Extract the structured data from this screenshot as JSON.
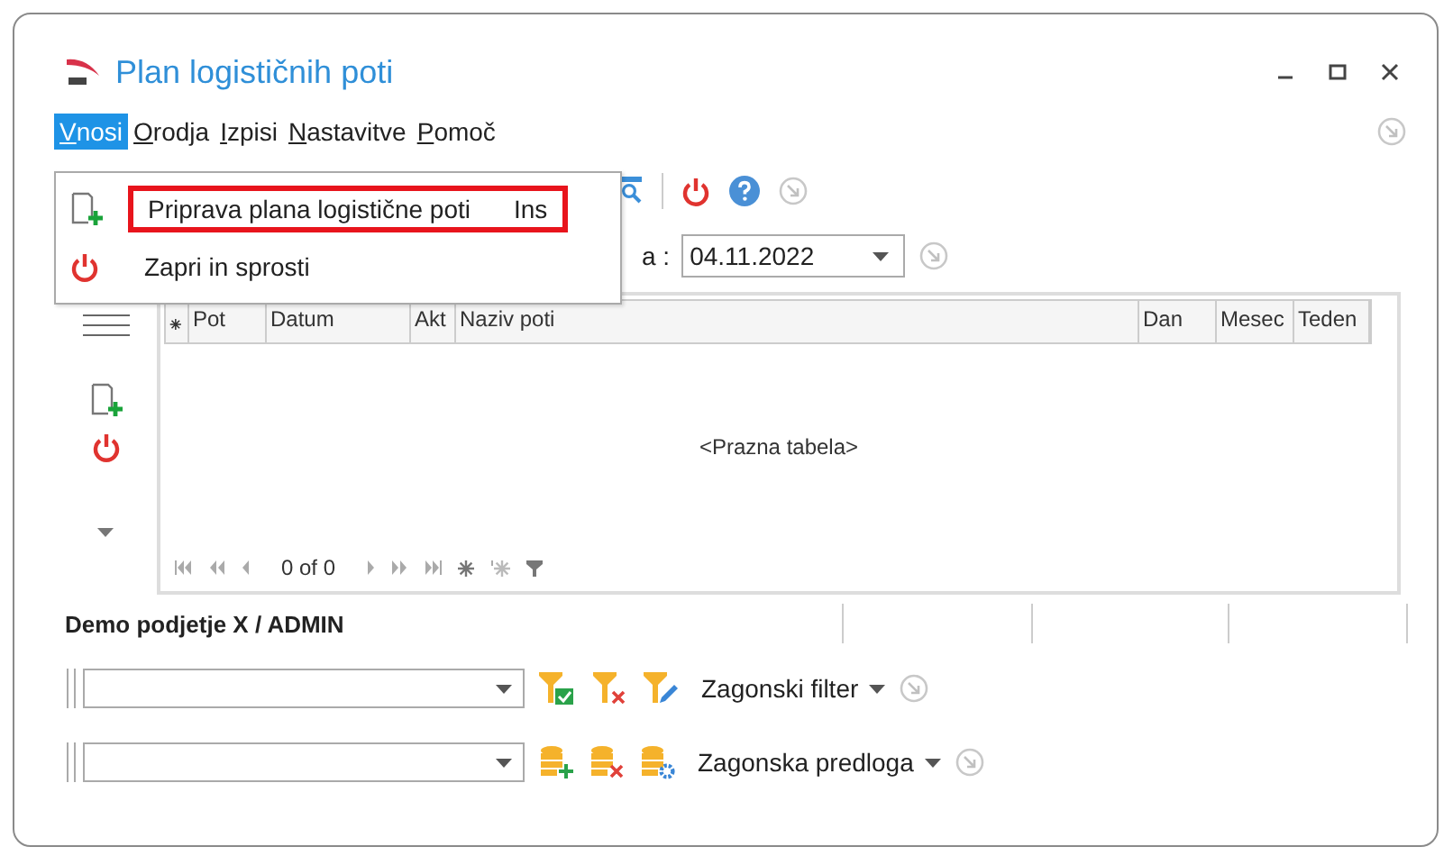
{
  "window": {
    "title": "Plan logističnih poti"
  },
  "menu": [
    {
      "label": "Vnosi",
      "selected": true
    },
    {
      "label": "Orodja",
      "selected": false
    },
    {
      "label": "Izpisi",
      "selected": false
    },
    {
      "label": "Nastavitve",
      "selected": false
    },
    {
      "label": "Pomoč",
      "selected": false
    }
  ],
  "dropdown": [
    {
      "kind": "new",
      "label": "Priprava plana logistične poti",
      "shortcut": "Ins",
      "highlighted": true
    },
    {
      "kind": "power",
      "label": "Zapri in sprosti",
      "highlighted": false
    }
  ],
  "date_filter": {
    "label": "a :",
    "value": "04.11.2022"
  },
  "table": {
    "columns": [
      "⁕",
      "Pot",
      "Datum",
      "Akt",
      "Naziv poti",
      "Dan",
      "Mesec",
      "Teden"
    ],
    "empty_text": "<Prazna tabela>",
    "navigator": "0 of 0"
  },
  "status_bar": {
    "company": "Demo podjetje X / ADMIN"
  },
  "filter": {
    "label": "Zagonski filter"
  },
  "template": {
    "label": "Zagonska predloga"
  }
}
